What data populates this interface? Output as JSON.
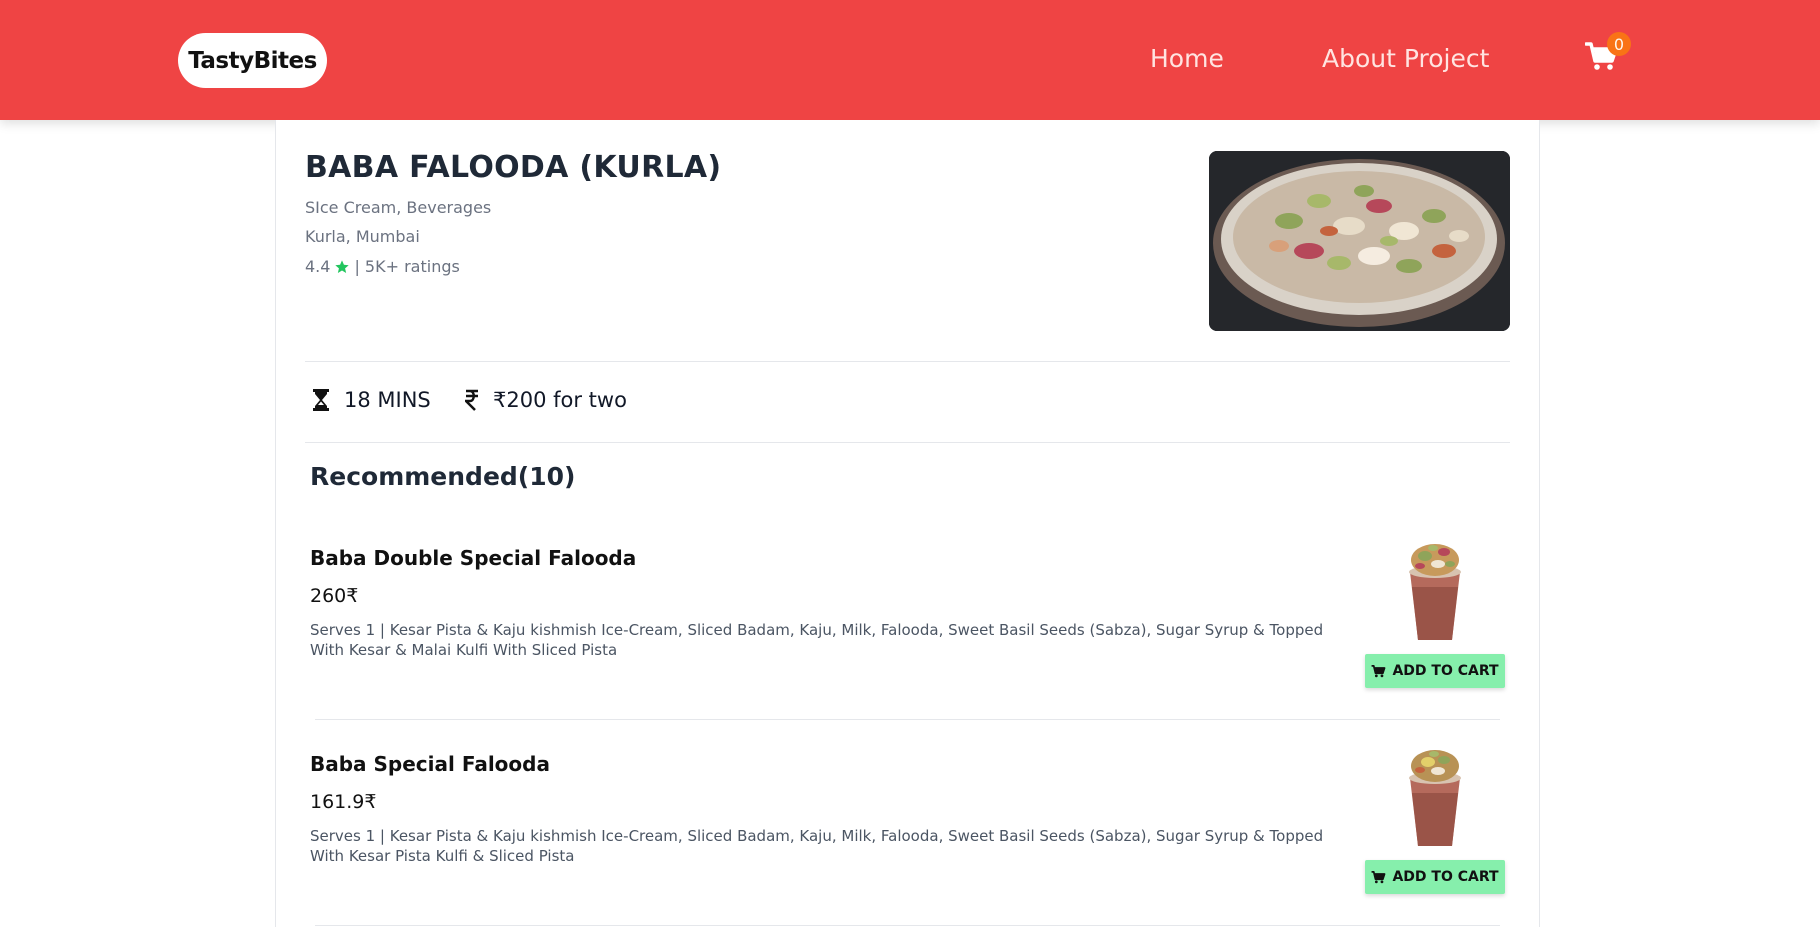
{
  "header": {
    "logo": "TastyBites",
    "nav": {
      "home": "Home",
      "about": "About Project"
    },
    "cart_count": "0",
    "colors": {
      "background": "#ef4444",
      "badge": "#f97316"
    }
  },
  "restaurant": {
    "name": "BABA FALOODA (KURLA)",
    "cuisines": "SIce Cream, Beverages",
    "location": "Kurla, Mumbai",
    "rating": "4.4",
    "ratings_count": "| 5K+ ratings",
    "image_icon": "falooda-bowl-photo",
    "rating_color": "#22c55e"
  },
  "info": {
    "delivery_time": "18 MINS",
    "cost_for_two": "₹200 for two",
    "time_icon": "hourglass-icon",
    "cost_icon": "rupee-icon"
  },
  "menu": {
    "section_title": "Recommended(10)",
    "add_label": "ADD TO CART",
    "button_color": "#86efac",
    "items": [
      {
        "name": "Baba Double Special Falooda",
        "price": "260₹",
        "description": "Serves 1 | Kesar Pista & Kaju kishmish Ice-Cream, Sliced Badam, Kaju, Milk, Falooda, Sweet Basil Seeds (Sabza), Sugar Syrup & Topped With Kesar & Malai Kulfi With Sliced Pista"
      },
      {
        "name": "Baba Special Falooda",
        "price": "161.9₹",
        "description": "Serves 1 | Kesar Pista & Kaju kishmish Ice-Cream, Sliced Badam, Kaju, Milk, Falooda, Sweet Basil Seeds (Sabza), Sugar Syrup & Topped With Kesar Pista Kulfi & Sliced Pista"
      }
    ]
  }
}
